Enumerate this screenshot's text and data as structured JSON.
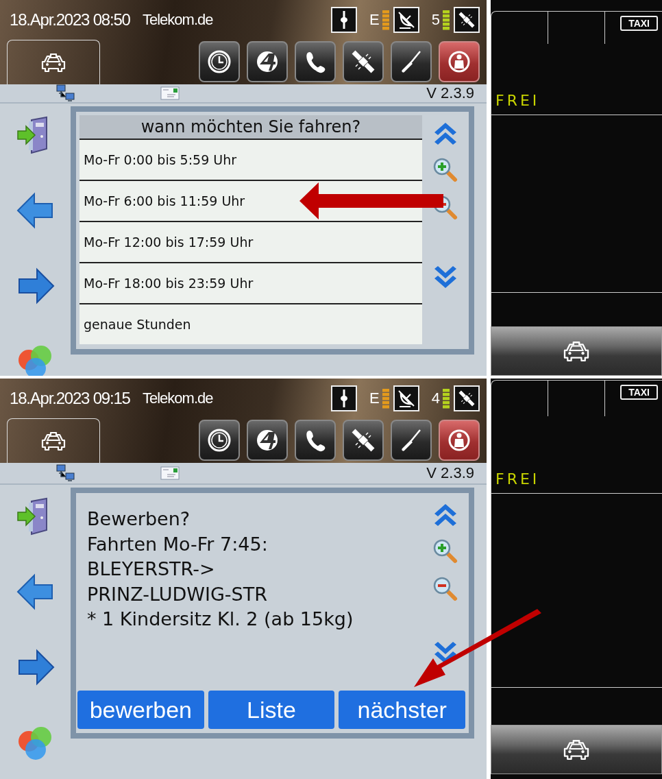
{
  "screens": [
    {
      "status": {
        "datetime": "18.Apr.2023 08:50",
        "operator": "Telekom.de",
        "network_type": "E",
        "satellite_count": "5"
      },
      "version": "V 2.3.9",
      "content": {
        "kind": "list",
        "title": "wann möchten Sie fahren?",
        "items": [
          "Mo-Fr 0:00 bis 5:59 Uhr",
          "Mo-Fr 6:00 bis 11:59 Uhr",
          "Mo-Fr 12:00 bis 17:59 Uhr",
          "Mo-Fr 18:00 bis 23:59 Uhr",
          "genaue Stunden"
        ]
      },
      "side_panel": {
        "sign": "TAXI",
        "state": "FREI"
      }
    },
    {
      "status": {
        "datetime": "18.Apr.2023 09:15",
        "operator": "Telekom.de",
        "network_type": "E",
        "satellite_count": "4"
      },
      "version": "V 2.3.9",
      "content": {
        "kind": "message",
        "lines": [
          "Bewerben?",
          "Fahrten Mo-Fr 7:45:",
          "BLEYERSTR->",
          "PRINZ-LUDWIG-STR",
          "* 1 Kindersitz Kl. 2 (ab 15kg)"
        ],
        "buttons": [
          "bewerben",
          "Liste",
          "nächster"
        ]
      },
      "side_panel": {
        "sign": "TAXI",
        "state": "FREI"
      }
    }
  ]
}
